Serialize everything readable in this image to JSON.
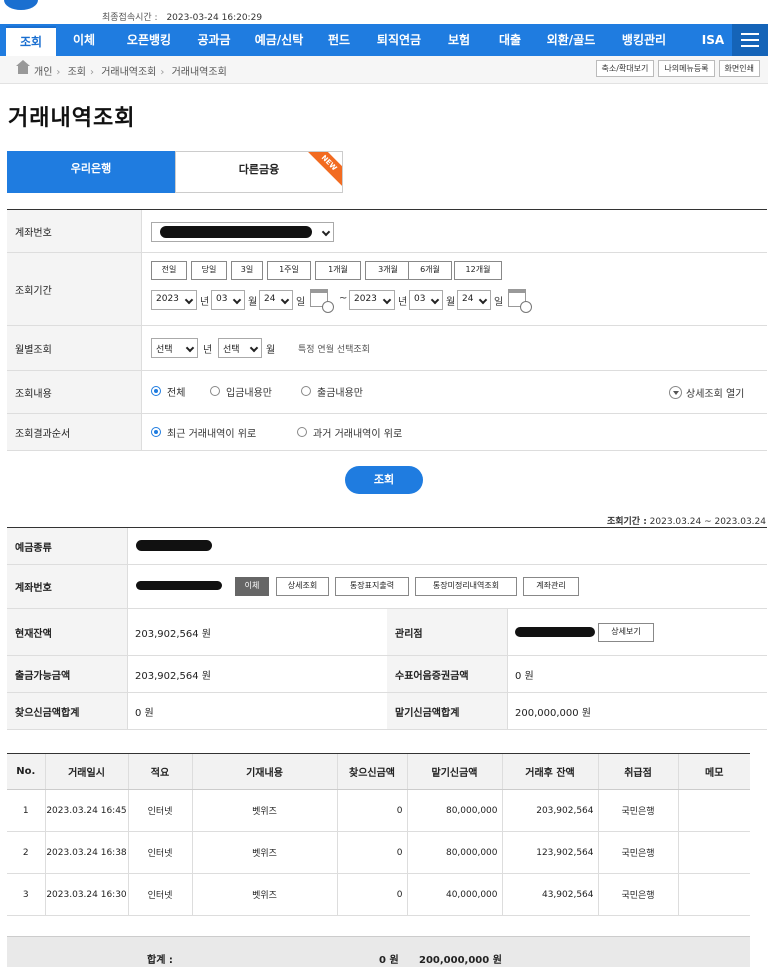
{
  "header": {
    "last_login_label": "최종접속시간 :",
    "last_login_value": "2023-03-24 16:20:29"
  },
  "nav": [
    "조회",
    "이체",
    "오픈뱅킹",
    "공과금",
    "예금/신탁",
    "펀드",
    "퇴직연금",
    "보험",
    "대출",
    "외환/골드",
    "뱅킹관리",
    "ISA"
  ],
  "breadcrumb": {
    "items": [
      "개인",
      "조회",
      "거래내역조회",
      "거래내역조회"
    ],
    "buttons": [
      "축소/확대보기",
      "나의메뉴등록",
      "화면인쇄"
    ]
  },
  "page_title": "거래내역조회",
  "bank_tabs": {
    "woori": "우리은행",
    "other": "다른금융",
    "badge": "NEW"
  },
  "search": {
    "account_label": "계좌번호",
    "period_label": "조회기간",
    "period_buttons": [
      "전일",
      "당일",
      "3일",
      "1주일",
      "1개월",
      "3개월",
      "6개월",
      "12개월"
    ],
    "from": {
      "year": "2023",
      "month": "03",
      "day": "24"
    },
    "to": {
      "year": "2023",
      "month": "03",
      "day": "24"
    },
    "unit_year": "년",
    "unit_month": "월",
    "unit_day": "일",
    "tilde": "~",
    "monthly_label": "월별조회",
    "monthly_year": "선택",
    "monthly_month": "선택",
    "monthly_hint": "특정 연월 선택조회",
    "content_label": "조회내용",
    "content_options": [
      "전체",
      "입금내용만",
      "출금내용만"
    ],
    "detail_toggle": "상세조회 열기",
    "order_label": "조회결과순서",
    "order_options": [
      "최근 거래내역이 위로",
      "과거 거래내역이 위로"
    ],
    "submit": "조회"
  },
  "period_display": {
    "label": "조회기간 :",
    "value": "2023.03.24 ~ 2023.03.24"
  },
  "account": {
    "type_label": "예금종류",
    "number_label": "계좌번호",
    "buttons": [
      "이체",
      "상세조회",
      "통장표지출력",
      "통장미정리내역조회",
      "계좌관리"
    ],
    "balance_label": "현재잔액",
    "balance": "203,902,564 원",
    "branch_label": "관리점",
    "branch_button": "상세보기",
    "withdrawable_label": "출금가능금액",
    "withdrawable": "203,902,564 원",
    "check_label": "수표어음증권금액",
    "check_amount": "0 원",
    "total_withdraw_label": "찾으신금액합계",
    "total_withdraw": "0 원",
    "total_deposit_label": "맡기신금액합계",
    "total_deposit": "200,000,000 원"
  },
  "transactions": {
    "headers": [
      "No.",
      "거래일시",
      "적요",
      "기재내용",
      "찾으신금액",
      "맡기신금액",
      "거래후 잔액",
      "취급점",
      "메모"
    ],
    "rows": [
      [
        "1",
        "2023.03.24 16:45",
        "인터넷",
        "벳위즈",
        "0",
        "80,000,000",
        "203,902,564",
        "국민은행",
        ""
      ],
      [
        "2",
        "2023.03.24 16:38",
        "인터넷",
        "벳위즈",
        "0",
        "80,000,000",
        "123,902,564",
        "국민은행",
        ""
      ],
      [
        "3",
        "2023.03.24 16:30",
        "인터넷",
        "벳위즈",
        "0",
        "40,000,000",
        "43,902,564",
        "국민은행",
        ""
      ]
    ],
    "sum_label": "합계 :",
    "sum_withdraw": "0 원",
    "sum_deposit": "200,000,000 원"
  },
  "colors": {
    "brand": "#1f7ce0",
    "badge": "#f26b21"
  }
}
